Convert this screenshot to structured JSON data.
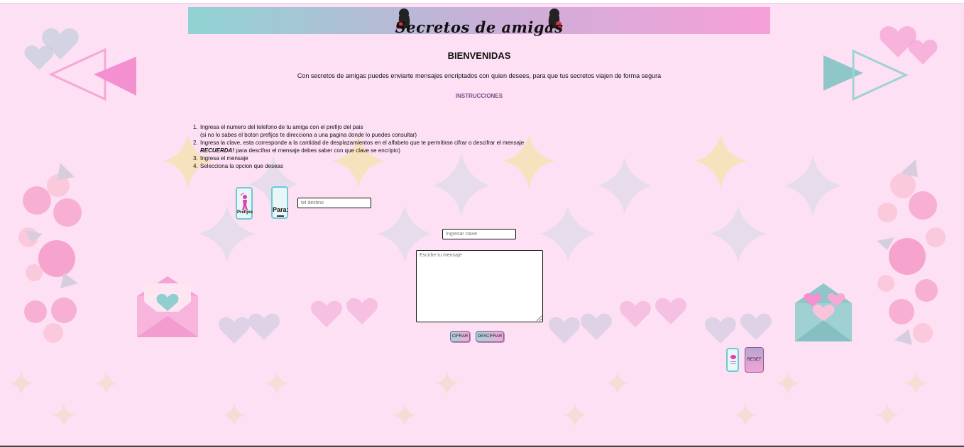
{
  "header": {
    "title": "Secretos de amigas"
  },
  "welcome": "BIENVENIDAS",
  "intro": "Con secretos de amigas puedes enviarte mensajes encriptados con quien desees, para que tus secretos viajen de forma segura",
  "instructions": {
    "title": "INSTRUCCIONES",
    "steps": [
      {
        "num": "1.",
        "text": "Ingresa el numero del telefono de tu amiga con el prefijo del pais",
        "sub": "(si no lo sabes el boton prefijos te direcciona a una pagina donde lo puedes consultar)"
      },
      {
        "num": "2.",
        "text": "Ingresa la clave, esta corresponde a la cantidad de desplazamientos en el alfabeto que te permitiran cifrar o descifrar el mensaje",
        "sub_em": "RECUERDA!",
        "sub": " para descifrar el mensaje debes saber con que clave se encripto)"
      },
      {
        "num": "3.",
        "text": "Ingresa el mensaje"
      },
      {
        "num": "4.",
        "text": "Selecciona la opcion que deseas"
      }
    ]
  },
  "buttons": {
    "prefijos": "Prefijos",
    "para": "Para:",
    "cifrar": "CIFRAR",
    "descifrar": "DESCIFRAR",
    "reset": "RESET"
  },
  "inputs": {
    "phone_placeholder": "tel destino",
    "key_placeholder": "Ingresar clave",
    "message_placeholder": "Escribe tu mensaje"
  },
  "colors": {
    "background": "#fde0f4",
    "banner_start": "#8fd3d3",
    "banner_end": "#f7a0d8",
    "accent_pink": "#f48fd0",
    "accent_teal": "#8fcfd0"
  }
}
